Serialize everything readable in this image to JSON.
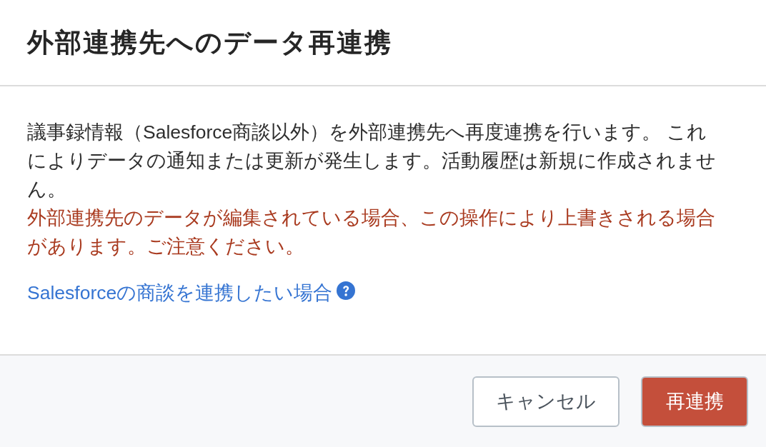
{
  "dialog": {
    "title": "外部連携先へのデータ再連携",
    "description": "議事録情報（Salesforce商談以外）を外部連携先へ再度連携を行います。 これによりデータの通知または更新が発生します。活動履歴は新規に作成されません。",
    "warning": "外部連携先のデータが編集されている場合、この操作により上書きされる場合があります。ご注意ください。",
    "help_link": "Salesforceの商談を連携したい場合"
  },
  "buttons": [
    {
      "label": "キャンセル",
      "kind": "secondary"
    },
    {
      "label": "再連携",
      "kind": "primary"
    }
  ]
}
